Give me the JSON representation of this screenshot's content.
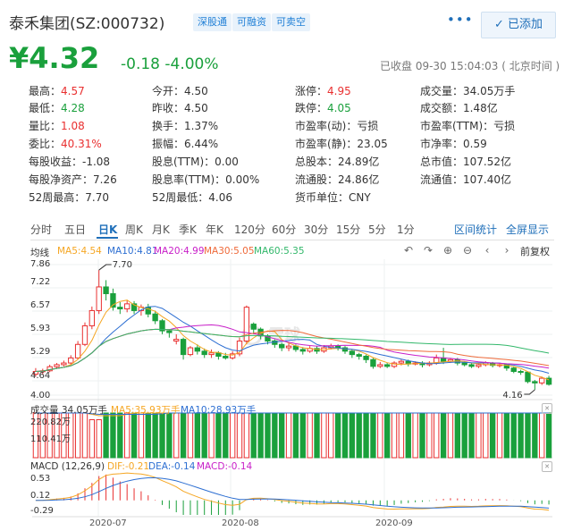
{
  "header": {
    "title": "泰禾集团(SZ:000732)",
    "tags": [
      "深股通",
      "可融资",
      "可卖空"
    ],
    "more_label": "•••",
    "add_label": "已添加"
  },
  "quote": {
    "price": "¥4.32",
    "change": "-0.18 -4.00%",
    "status": "已收盘 09-30 15:04:03 ( 北京时间 )",
    "rows": [
      [
        [
          "最高：",
          "4.57",
          "red"
        ],
        [
          "今开：",
          "4.50",
          ""
        ],
        [
          "涨停：",
          "4.95",
          "red"
        ],
        [
          "成交量：",
          "34.05万手",
          ""
        ]
      ],
      [
        [
          "最低：",
          "4.28",
          "green"
        ],
        [
          "昨收：",
          "4.50",
          ""
        ],
        [
          "跌停：",
          "4.05",
          "green"
        ],
        [
          "成交额：",
          "1.48亿",
          ""
        ]
      ],
      [
        [
          "量比：",
          "1.08",
          "red"
        ],
        [
          "换手：",
          "1.37%",
          ""
        ],
        [
          "市盈率(动)：",
          "亏损",
          ""
        ],
        [
          "市盈率(TTM)：",
          "亏损",
          ""
        ]
      ],
      [
        [
          "委比：",
          "40.31%",
          "red"
        ],
        [
          "振幅：",
          "6.44%",
          ""
        ],
        [
          "市盈率(静)：",
          "23.05",
          ""
        ],
        [
          "市净率：",
          "0.59",
          ""
        ]
      ],
      [
        [
          "每股收益：",
          "-1.08",
          ""
        ],
        [
          "股息(TTM)：",
          "0.00",
          ""
        ],
        [
          "总股本：",
          "24.89亿",
          ""
        ],
        [
          "总市值：",
          "107.52亿",
          ""
        ]
      ],
      [
        [
          "每股净资产：",
          "7.26",
          ""
        ],
        [
          "股息率(TTM)：",
          "0.00%",
          ""
        ],
        [
          "流通股：",
          "24.86亿",
          ""
        ],
        [
          "流通值：",
          "107.40亿",
          ""
        ]
      ],
      [
        [
          "52周最高：",
          "7.70",
          ""
        ],
        [
          "52周最低：",
          "4.06",
          ""
        ],
        [
          "货币单位：",
          "CNY",
          ""
        ],
        [
          "",
          "",
          ""
        ]
      ]
    ]
  },
  "tabs": [
    "分时",
    "五日",
    "日K",
    "周K",
    "月K",
    "季K",
    "年K",
    "120分",
    "60分",
    "30分",
    "15分",
    "5分",
    "1分"
  ],
  "active_tab": "日K",
  "links": {
    "interval_stats": "区间统计",
    "fullscreen": "全屏显示"
  },
  "toolbar": {
    "restore": "前复权"
  },
  "kline_legend": {
    "label": "均线",
    "ma": [
      {
        "text": "MA5:4.54",
        "color": "#f5a623"
      },
      {
        "text": "MA10:4.81",
        "color": "#2d6fd2"
      },
      {
        "text": "MA20:4.99",
        "color": "#c81fc8"
      },
      {
        "text": "MA30:5.05",
        "color": "#ef6a3a"
      },
      {
        "text": "MA60:5.35",
        "color": "#33b86b"
      }
    ]
  },
  "volume_legend": {
    "label": "成交量 34.05万手",
    "ma5": "MA5:35.93万手",
    "ma10": "MA10:28.93万手"
  },
  "macd_legend": {
    "label": "MACD (12,26,9)",
    "dif": "DIF:-0.21",
    "dea": "DEA:-0.14",
    "macd": "MACD:-0.14"
  },
  "watermark": "雪球",
  "axes": {
    "kline_y": [
      "7.86",
      "7.22",
      "6.57",
      "5.93",
      "5.29",
      "4.64",
      "4.00"
    ],
    "volume_y": [
      "220.82万",
      "110.41万"
    ],
    "macd_y": [
      "0.53",
      "0.12",
      "-0.29"
    ],
    "x": [
      "2020-07",
      "2020-08",
      "2020-09"
    ]
  },
  "chart_data": {
    "type": "candlestick",
    "ylim": [
      4.0,
      7.86
    ],
    "annotations": [
      {
        "label": "7.70",
        "value": 7.7
      },
      {
        "label": "4.16",
        "value": 4.16
      }
    ],
    "candles": [
      [
        4.62,
        4.7,
        4.55,
        4.8
      ],
      [
        4.7,
        4.72,
        4.62,
        4.78
      ],
      [
        4.72,
        4.84,
        4.68,
        4.9
      ],
      [
        4.84,
        4.9,
        4.78,
        4.95
      ],
      [
        4.9,
        4.95,
        4.85,
        5.02
      ],
      [
        4.95,
        5.1,
        4.9,
        5.18
      ],
      [
        5.1,
        5.5,
        5.05,
        5.6
      ],
      [
        5.5,
        6.05,
        5.45,
        6.15
      ],
      [
        6.05,
        6.5,
        5.95,
        6.62
      ],
      [
        6.5,
        7.2,
        6.4,
        7.7
      ],
      [
        7.2,
        7.0,
        6.8,
        7.4
      ],
      [
        7.0,
        6.6,
        6.5,
        7.15
      ],
      [
        6.6,
        6.55,
        6.4,
        6.75
      ],
      [
        6.55,
        6.7,
        6.45,
        6.8
      ],
      [
        6.7,
        6.5,
        6.4,
        6.78
      ],
      [
        6.5,
        6.6,
        6.35,
        6.68
      ],
      [
        6.6,
        6.4,
        6.3,
        6.7
      ],
      [
        6.4,
        6.2,
        6.1,
        6.5
      ],
      [
        6.2,
        5.9,
        5.8,
        6.25
      ],
      [
        5.9,
        5.85,
        5.7,
        5.95
      ],
      [
        5.6,
        5.65,
        5.5,
        5.8
      ],
      [
        5.65,
        5.2,
        5.05,
        5.7
      ],
      [
        5.2,
        5.4,
        5.15,
        5.45
      ],
      [
        5.4,
        5.3,
        5.2,
        5.5
      ],
      [
        5.3,
        5.2,
        5.1,
        5.38
      ],
      [
        5.2,
        5.25,
        5.1,
        5.35
      ],
      [
        5.25,
        5.15,
        5.05,
        5.3
      ],
      [
        5.15,
        5.1,
        5.05,
        5.25
      ],
      [
        5.1,
        5.22,
        5.05,
        5.3
      ],
      [
        5.22,
        5.6,
        5.15,
        5.7
      ],
      [
        5.6,
        6.6,
        5.5,
        6.65
      ],
      [
        6.1,
        5.95,
        5.8,
        6.15
      ],
      [
        5.95,
        5.75,
        5.65,
        6.0
      ],
      [
        5.75,
        5.6,
        5.5,
        5.8
      ],
      [
        5.6,
        5.5,
        5.4,
        5.65
      ],
      [
        5.5,
        5.4,
        5.3,
        5.55
      ],
      [
        5.4,
        5.45,
        5.3,
        5.55
      ],
      [
        5.45,
        5.35,
        5.28,
        5.5
      ],
      [
        5.35,
        5.3,
        5.2,
        5.42
      ],
      [
        5.3,
        5.38,
        5.25,
        5.45
      ],
      [
        5.38,
        5.3,
        5.22,
        5.45
      ],
      [
        5.3,
        5.4,
        5.25,
        5.48
      ],
      [
        5.4,
        5.45,
        5.35,
        5.52
      ],
      [
        5.45,
        5.4,
        5.32,
        5.5
      ],
      [
        5.4,
        5.3,
        5.22,
        5.45
      ],
      [
        5.3,
        5.2,
        5.1,
        5.35
      ],
      [
        5.2,
        5.15,
        5.05,
        5.25
      ],
      [
        5.15,
        5.05,
        4.95,
        5.2
      ],
      [
        5.05,
        4.85,
        4.78,
        5.1
      ],
      [
        4.85,
        4.9,
        4.8,
        4.98
      ],
      [
        4.9,
        4.85,
        4.8,
        4.95
      ],
      [
        4.85,
        4.95,
        4.8,
        5.0
      ],
      [
        4.95,
        5.0,
        4.88,
        5.05
      ],
      [
        5.0,
        4.92,
        4.85,
        5.05
      ],
      [
        4.92,
        4.95,
        4.88,
        5.0
      ],
      [
        4.95,
        4.9,
        4.82,
        5.0
      ],
      [
        4.9,
        4.95,
        4.85,
        5.0
      ],
      [
        4.95,
        5.1,
        4.9,
        5.2
      ],
      [
        5.1,
        5.0,
        4.92,
        5.4
      ],
      [
        5.0,
        5.05,
        4.95,
        5.1
      ],
      [
        5.05,
        4.95,
        4.88,
        5.1
      ],
      [
        4.95,
        4.9,
        4.85,
        5.0
      ],
      [
        4.9,
        4.85,
        4.8,
        4.95
      ],
      [
        4.85,
        4.9,
        4.8,
        4.95
      ],
      [
        4.9,
        4.95,
        4.85,
        5.0
      ],
      [
        4.95,
        4.88,
        4.82,
        4.98
      ],
      [
        4.88,
        4.9,
        4.82,
        4.95
      ],
      [
        4.9,
        4.8,
        4.72,
        4.92
      ],
      [
        4.8,
        4.7,
        4.65,
        4.85
      ],
      [
        4.7,
        4.68,
        4.6,
        4.75
      ],
      [
        4.68,
        4.4,
        4.35,
        4.7
      ],
      [
        4.4,
        4.36,
        4.16,
        4.45
      ],
      [
        4.36,
        4.5,
        4.3,
        4.55
      ],
      [
        4.5,
        4.32,
        4.28,
        4.57
      ]
    ]
  }
}
